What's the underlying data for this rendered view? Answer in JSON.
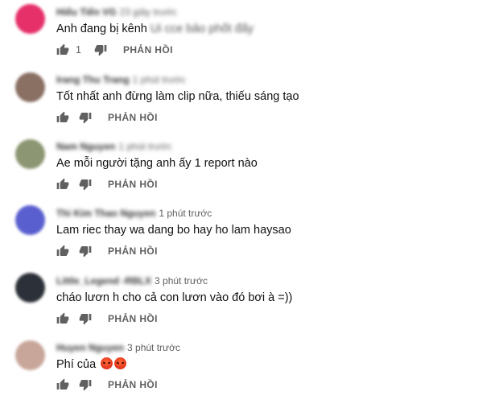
{
  "reply_label": "PHẢN HỒI",
  "comments": [
    {
      "author": "Hiếu Tiến VG",
      "time": "23 giây trước",
      "text": "Anh đang bị kênh",
      "text_blurred": "Ui cce bảo phốt đấy",
      "likes": "1",
      "avatar_color": "#e5306a"
    },
    {
      "author": "Irang Thu Trang",
      "time": "1 phút trước",
      "text": "Tốt nhất anh đừng làm clip nữa, thiếu sáng tạo",
      "likes": "",
      "avatar_color": "#8a6f63"
    },
    {
      "author": "Nam Nguyen",
      "time": "1 phút trước",
      "text": "Ae mỗi người tặng anh ấy 1 report nào",
      "likes": "",
      "avatar_color": "#8d9672"
    },
    {
      "author": "Thi Kim Thao Nguyen",
      "time": "1 phút trước",
      "text": "Lam riec thay wa dang bo hay ho lam haysao",
      "likes": "",
      "avatar_color": "#5a5fcf"
    },
    {
      "author": "Little_Legend -RBLX",
      "time": "3 phút trước",
      "text": "cháo lươn h cho cả con lươn vào đó bơi à =))",
      "likes": "",
      "avatar_color": "#2c3038"
    },
    {
      "author": "Huyen Nguyen",
      "time": "3 phút trước",
      "text": "Phí của",
      "emojis": [
        "angry-face",
        "angry-face"
      ],
      "likes": "",
      "avatar_color": "#c8a69a"
    }
  ]
}
